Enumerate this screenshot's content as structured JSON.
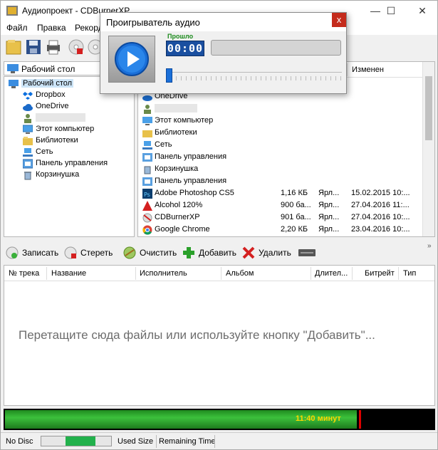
{
  "window": {
    "title": "Аудиопроект - CDBurnerXP",
    "min": "—",
    "max": "☐",
    "close": "✕"
  },
  "menu": [
    "Файл",
    "Правка",
    "Рекорд"
  ],
  "tree": {
    "dropdown_value": "Рабочий стол",
    "items": [
      {
        "label": "Рабочий стол",
        "icon": "desktop-icon"
      },
      {
        "label": "Dropbox",
        "icon": "dropbox-icon"
      },
      {
        "label": "OneDrive",
        "icon": "onedrive-icon"
      },
      {
        "label": "",
        "icon": "user-icon"
      },
      {
        "label": "Этот компьютер",
        "icon": "computer-icon"
      },
      {
        "label": "Библиотеки",
        "icon": "folder-icon"
      },
      {
        "label": "Сеть",
        "icon": "network-icon"
      },
      {
        "label": "Панель управления",
        "icon": "control-panel-icon"
      },
      {
        "label": "Корзинушка",
        "icon": "recycle-bin-icon"
      }
    ]
  },
  "filelist": {
    "header_modified": "Изменен",
    "rows": [
      {
        "name": "OneDrive",
        "size": "",
        "type": "",
        "date": ""
      },
      {
        "name": "",
        "size": "",
        "type": "",
        "date": ""
      },
      {
        "name": "Этот компьютер",
        "size": "",
        "type": "",
        "date": ""
      },
      {
        "name": "Библиотеки",
        "size": "",
        "type": "",
        "date": ""
      },
      {
        "name": "Сеть",
        "size": "",
        "type": "",
        "date": ""
      },
      {
        "name": "Панель управления",
        "size": "",
        "type": "",
        "date": ""
      },
      {
        "name": "Корзинушка",
        "size": "",
        "type": "",
        "date": ""
      },
      {
        "name": "Панель управления",
        "size": "",
        "type": "",
        "date": ""
      },
      {
        "name": "Adobe Photoshop CS5",
        "size": "1,16 КБ",
        "type": "Ярл...",
        "date": "15.02.2015 10:..."
      },
      {
        "name": "Alcohol 120%",
        "size": "900 ба...",
        "type": "Ярл...",
        "date": "27.04.2016 11:..."
      },
      {
        "name": "CDBurnerXP",
        "size": "901 ба...",
        "type": "Ярл...",
        "date": "27.04.2016 10:..."
      },
      {
        "name": "Google Chrome",
        "size": "2,20 КБ",
        "type": "Ярл...",
        "date": "23.04.2016 10:..."
      }
    ]
  },
  "actions": {
    "record": "Записать",
    "erase": "Стереть",
    "clear": "Очистить",
    "add": "Добавить",
    "remove": "Удалить"
  },
  "tracks": {
    "columns": [
      "№ трека",
      "Название",
      "Исполнитель",
      "Альбом",
      "Длител...",
      "Битрейт",
      "Тип"
    ],
    "hint": "Перетащите сюда файлы или используйте кнопку \"Добавить\"..."
  },
  "capacity": {
    "label": "11:40 минут",
    "fill_fraction": 0.82
  },
  "status": {
    "disc": "No Disc",
    "used": "Used Size",
    "remaining": "Remaining Time",
    "meter_fraction": 0.65
  },
  "player": {
    "title": "Проигрыватель аудио",
    "close": "x",
    "elapsed_label": "Прошло",
    "time": "00:00",
    "seek_fraction": 0
  },
  "colors": {
    "accent": "#1a6fd8",
    "progress_green": "#3cc13c",
    "elapsed_green": "#1a8a1a"
  }
}
